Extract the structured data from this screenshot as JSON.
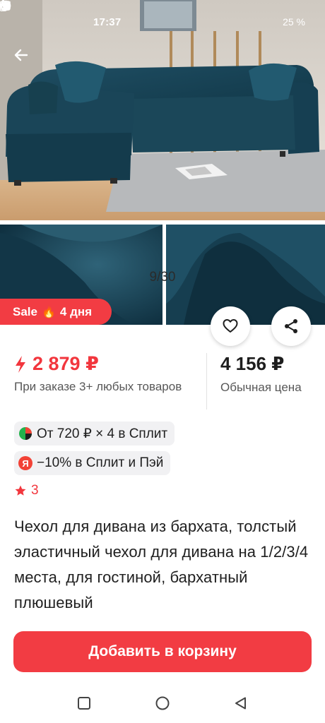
{
  "status_bar": {
    "time": "17:37",
    "battery": "25 %",
    "icons": [
      "telegram-icon",
      "whatsapp-icon",
      "dot-icon",
      "nfc-icon",
      "alarm-icon",
      "wifi-icon",
      "signal-icon",
      "signal-icon",
      "battery-icon"
    ]
  },
  "gallery": {
    "counter": "9/30",
    "sale_badge": "Sale",
    "sale_days": "4 дня"
  },
  "price": {
    "current": "2 879 ₽",
    "condition": "При заказе 3+ любых товаров",
    "regular": "4 156 ₽",
    "regular_label": "Обычная цена"
  },
  "promos": {
    "split": "От 720 ₽ × 4 в Сплит",
    "pay": "−10% в Сплит и Пэй",
    "pay_icon_letter": "Я"
  },
  "rating": {
    "value": "3"
  },
  "product": {
    "title": "Чехол для дивана из бархата, толстый эластичный чехол для дивана на 1/2/3/4 места, для гостиной, бархатный плюшевый"
  },
  "actions": {
    "add_to_cart": "Добавить в корзину"
  },
  "colors": {
    "accent": "#f23c43",
    "sofa": "#1d4a5e"
  }
}
